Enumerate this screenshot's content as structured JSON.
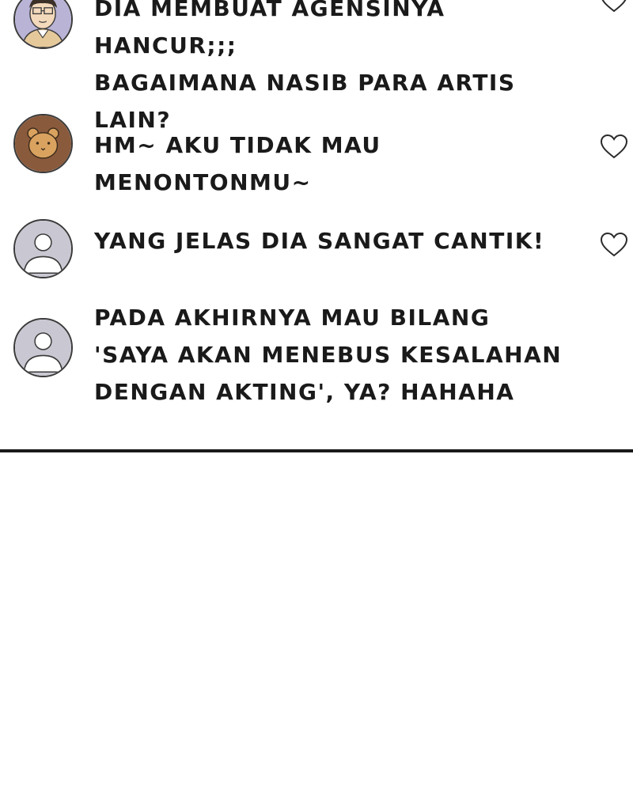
{
  "comments": [
    {
      "avatar": "glasses-man-avatar",
      "text": "DIA MEMBUAT AGENSINYA HANCUR;;;\nBAGAIMANA NASIB PARA ARTIS LAIN?",
      "liked": false
    },
    {
      "avatar": "bear-avatar",
      "text": "HM~ AKU TIDAK MAU MENONTONMU~",
      "liked": false
    },
    {
      "avatar": "default-user-avatar",
      "text": "YANG JELAS DIA SANGAT CANTIK!",
      "liked": false
    },
    {
      "avatar": "default-user-avatar",
      "text": "PADA AKHIRNYA MAU BILANG\n'SAYA AKAN MENEBUS KESALAHAN\nDENGAN AKTING', YA? HAHAHA"
    }
  ],
  "colors": {
    "default_avatar_bg": "#c9c8d2",
    "bear_avatar_bg": "#8a5a3c",
    "bear_face": "#d9a25f",
    "glasses_avatar_bg": "#b9b3d6",
    "text": "#1a1a1a"
  }
}
